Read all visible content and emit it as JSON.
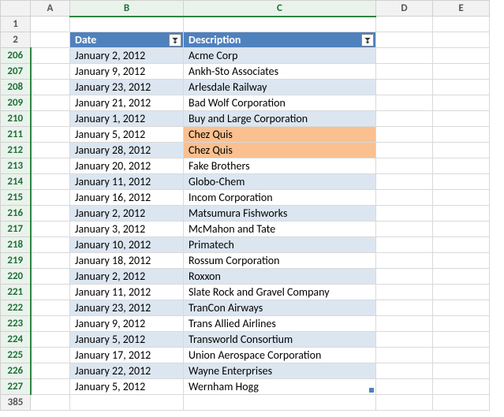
{
  "columns": [
    "A",
    "B",
    "C",
    "D",
    "E"
  ],
  "header_row_number": 2,
  "pre_rows": [
    1
  ],
  "post_rows": [
    385
  ],
  "headers": {
    "B": "Date",
    "C": "Description"
  },
  "rows": [
    {
      "n": 206,
      "date": "January 2, 2012",
      "desc": "Acme Corp",
      "band": 0
    },
    {
      "n": 207,
      "date": "January 9, 2012",
      "desc": "Ankh-Sto Associates",
      "band": 1
    },
    {
      "n": 208,
      "date": "January 23, 2012",
      "desc": "Arlesdale Railway",
      "band": 0
    },
    {
      "n": 209,
      "date": "January 21, 2012",
      "desc": "Bad Wolf Corporation",
      "band": 1
    },
    {
      "n": 210,
      "date": "January 1, 2012",
      "desc": "Buy and Large Corporation",
      "band": 0
    },
    {
      "n": 211,
      "date": "January 5, 2012",
      "desc": "Chez Quis",
      "band": 1,
      "desc_highlight": true
    },
    {
      "n": 212,
      "date": "January 28, 2012",
      "desc": "Chez Quis",
      "band": 0,
      "desc_highlight": true
    },
    {
      "n": 213,
      "date": "January 20, 2012",
      "desc": "Fake Brothers",
      "band": 1
    },
    {
      "n": 214,
      "date": "January 11, 2012",
      "desc": "Globo-Chem",
      "band": 0
    },
    {
      "n": 215,
      "date": "January 16, 2012",
      "desc": "Incom Corporation",
      "band": 1
    },
    {
      "n": 216,
      "date": "January 2, 2012",
      "desc": "Matsumura Fishworks",
      "band": 0
    },
    {
      "n": 217,
      "date": "January 3, 2012",
      "desc": "McMahon and Tate",
      "band": 1
    },
    {
      "n": 218,
      "date": "January 10, 2012",
      "desc": "Primatech",
      "band": 0
    },
    {
      "n": 219,
      "date": "January 18, 2012",
      "desc": "Rossum Corporation",
      "band": 1
    },
    {
      "n": 220,
      "date": "January 2, 2012",
      "desc": "Roxxon",
      "band": 0
    },
    {
      "n": 221,
      "date": "January 11, 2012",
      "desc": "Slate Rock and Gravel Company",
      "band": 1
    },
    {
      "n": 222,
      "date": "January 23, 2012",
      "desc": "TranCon Airways",
      "band": 0
    },
    {
      "n": 223,
      "date": "January 9, 2012",
      "desc": "Trans Allied Airlines",
      "band": 1
    },
    {
      "n": 224,
      "date": "January 5, 2012",
      "desc": "Transworld Consortium",
      "band": 0
    },
    {
      "n": 225,
      "date": "January 17, 2012",
      "desc": "Union Aerospace Corporation",
      "band": 1
    },
    {
      "n": 226,
      "date": "January 22, 2012",
      "desc": "Wayne Enterprises",
      "band": 0
    },
    {
      "n": 227,
      "date": "January 5, 2012",
      "desc": "Wernham Hogg",
      "band": 1,
      "last": true
    }
  ]
}
